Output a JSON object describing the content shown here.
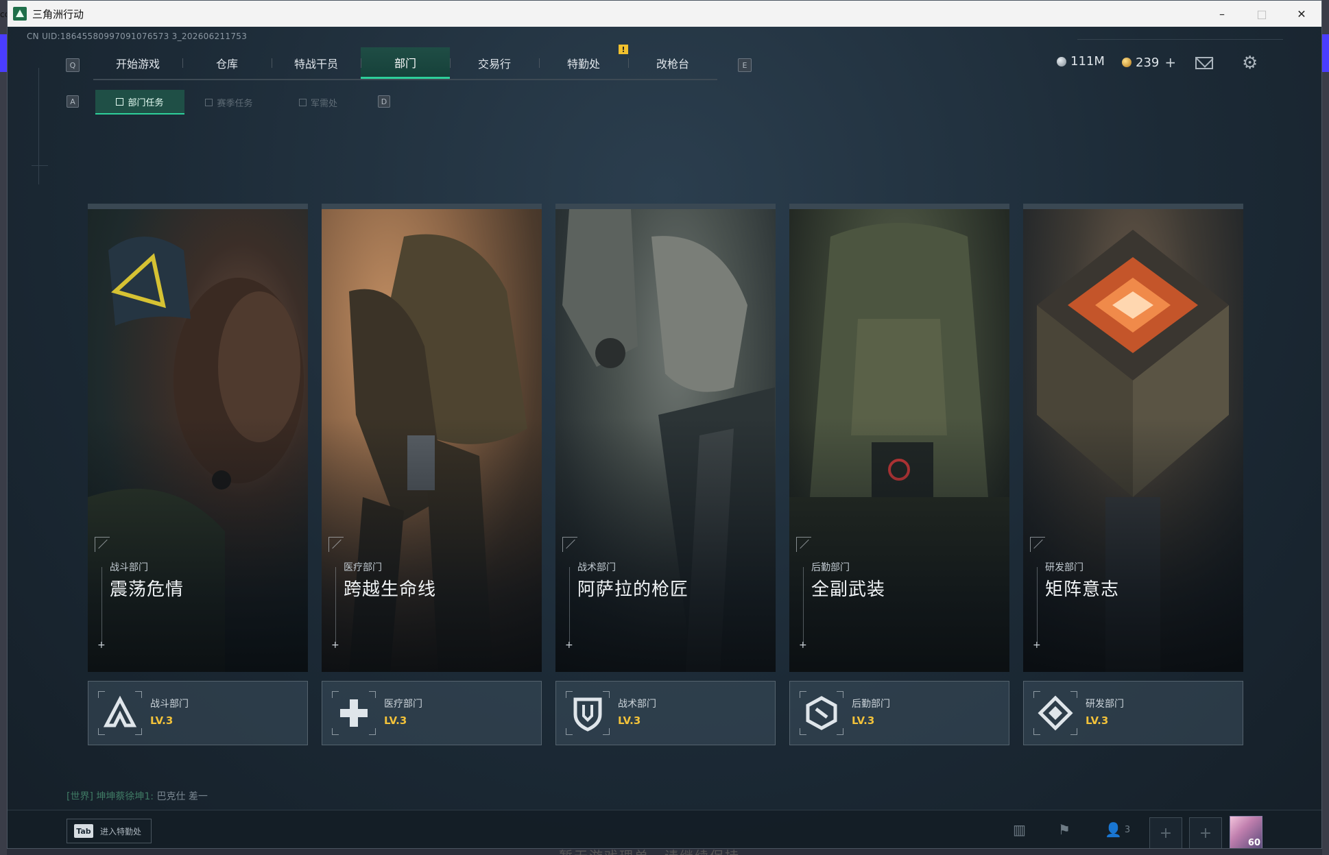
{
  "desktop": {
    "left_letters": "cc",
    "bottom_text": "暂无游戏理单，请继续保持"
  },
  "window": {
    "title": "三角洲行动",
    "minimize": "–",
    "maximize": "□",
    "close": "✕"
  },
  "uid": "CN UID:18645580997091076573 3_202606211753",
  "nav": {
    "left_key": "Q",
    "right_key": "E",
    "tabs": [
      "开始游戏",
      "仓库",
      "特战干员",
      "部门",
      "交易行",
      "特勤处",
      "改枪台"
    ],
    "active_index": 3
  },
  "currency": {
    "silver": "111M",
    "gold": "239",
    "plus": "+"
  },
  "subnav": {
    "left_key": "A",
    "right_key": "D",
    "tabs": [
      "部门任务",
      "赛季任务",
      "军需处"
    ],
    "active_index": 0
  },
  "cards": [
    {
      "category": "战斗部门",
      "title": "震荡危情",
      "dept": "战斗部门",
      "level": "LV.3",
      "icon": "combat-triangle-icon",
      "plus": "+"
    },
    {
      "category": "医疗部门",
      "title": "跨越生命线",
      "dept": "医疗部门",
      "level": "LV.3",
      "icon": "medical-cross-icon",
      "plus": "+"
    },
    {
      "category": "战术部门",
      "title": "阿萨拉的枪匠",
      "dept": "战术部门",
      "level": "LV.3",
      "icon": "tactical-shield-icon",
      "plus": "+"
    },
    {
      "category": "后勤部门",
      "title": "全副武装",
      "dept": "后勤部门",
      "level": "LV.3",
      "icon": "logistics-hex-icon",
      "plus": "+"
    },
    {
      "category": "研发部门",
      "title": "矩阵意志",
      "dept": "研发部门",
      "level": "LV.3",
      "icon": "research-diamond-icon",
      "plus": "+"
    }
  ],
  "chat": {
    "channel": "[世界]",
    "user": "坤坤蔡徐坤1:",
    "message": "巴克仕 差一"
  },
  "bottombar": {
    "tab_key": "Tab",
    "tab_label": "进入特勤处",
    "team_count": "3",
    "slot_plus": "+",
    "avatar_level": "60"
  },
  "colors": {
    "accent": "#2ecf9a",
    "level": "#f2c23a",
    "background": "#1b2833"
  }
}
